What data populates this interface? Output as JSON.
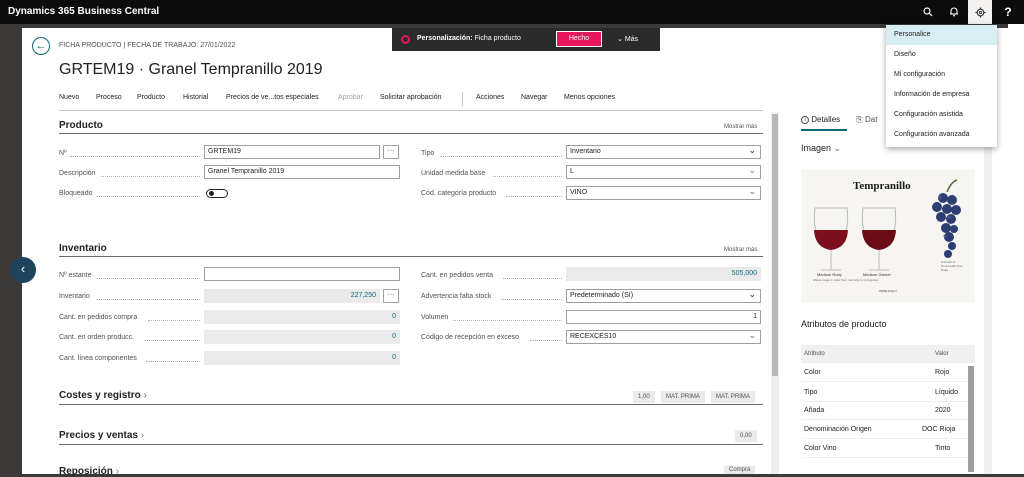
{
  "topbar": {
    "app_title": "Dynamics 365 Business Central",
    "search_glyph": "⌕",
    "bell_glyph": "🔔",
    "gear_glyph": "⚙",
    "help_glyph": "?"
  },
  "header": {
    "caption": "FICHA PRODUCTO | FECHA DE TRABAJO: 27/01/2022",
    "title": "GRTEM19 · Granel Tempranillo 2019",
    "back_glyph": "←"
  },
  "actions": [
    "Nuevo",
    "Proceso",
    "Producto",
    "Historial",
    "Precios de ve...tos especiales",
    "Aprobar",
    "Solicitar aprobación",
    "Acciones",
    "Navegar",
    "Menos opciones"
  ],
  "producto": {
    "heading": "Producto",
    "show_more": "Mostrar más",
    "fields": {
      "no_label": "Nº",
      "no_value": "GRTEM19",
      "desc_label": "Descripción",
      "desc_value": "Granel Tempranillo 2019",
      "bloq_label": "Bloqueado",
      "tipo_label": "Tipo",
      "tipo_value": "Inventario",
      "umb_label": "Unidad medida base",
      "umb_value": "L",
      "cat_label": "Cód. categoría producto",
      "cat_value": "VINO"
    }
  },
  "inventario": {
    "heading": "Inventario",
    "show_more": "Mostrar más",
    "fields": {
      "estante_label": "Nº estante",
      "estante_value": "",
      "inv_label": "Inventario",
      "inv_value": "227,250",
      "pedcompra_label": "Cant. en pedidos compra",
      "pedcompra_value": "0",
      "ordenprod_label": "Cant. en orden producc.",
      "ordenprod_value": "0",
      "linea_label": "Cant. línea componentes",
      "linea_value": "0",
      "pedventa_label": "Cant. en pedidos venta",
      "pedventa_value": "505,000",
      "adv_label": "Advertencia falta stock",
      "adv_value": "Predeterminado (Sí)",
      "vol_label": "Volumen",
      "vol_value": "1",
      "recep_label": "Código de recepción en exceso",
      "recep_value": "RECEXCES10"
    }
  },
  "costes": {
    "heading": "Costes y registro",
    "chips": [
      "1,00",
      "MAT. PRIMA",
      "MAT. PRIMA"
    ]
  },
  "precios": {
    "heading": "Precios y ventas",
    "chips": [
      "0,00"
    ]
  },
  "reposicion": {
    "heading": "Reposición",
    "chips": [
      "Compra"
    ]
  },
  "factbox": {
    "tab_details": "Detalles",
    "tab_attachments": "Dat",
    "image_heading": "Imagen",
    "image_title": "Tempranillo",
    "image_label_1": "Medium Ruby",
    "image_label_2": "Medium Garnet",
    "image_caption": "Wines range in color from mid ruby to mid garnet.",
    "image_brand": "WINE FOLLY",
    "image_side_text": "A bunch of Tempranillo from Rioja",
    "attr_heading": "Atributos de producto",
    "attr_col_1": "Atributo",
    "attr_col_2": "Valor",
    "attributes": [
      {
        "name": "Color",
        "value": "Rojo"
      },
      {
        "name": "Tipo",
        "value": "Líquido"
      },
      {
        "name": "Añada",
        "value": "2020"
      },
      {
        "name": "Denominación Origen",
        "value": "DOC Rioja"
      },
      {
        "name": "Color Vino",
        "value": "Tinto"
      }
    ]
  },
  "toast": {
    "label": "Personalización:",
    "context": "Ficha producto",
    "done": "Hecho",
    "more": "Más"
  },
  "settings_menu": [
    "Personalice",
    "Diseño",
    "Mi configuración",
    "Información de empresa",
    "Configuración asistida",
    "Configuración avanzada"
  ],
  "colors": {
    "accent": "#0b6a7a",
    "toast_red": "#e8175d",
    "topbar": "#0c0c0c"
  }
}
